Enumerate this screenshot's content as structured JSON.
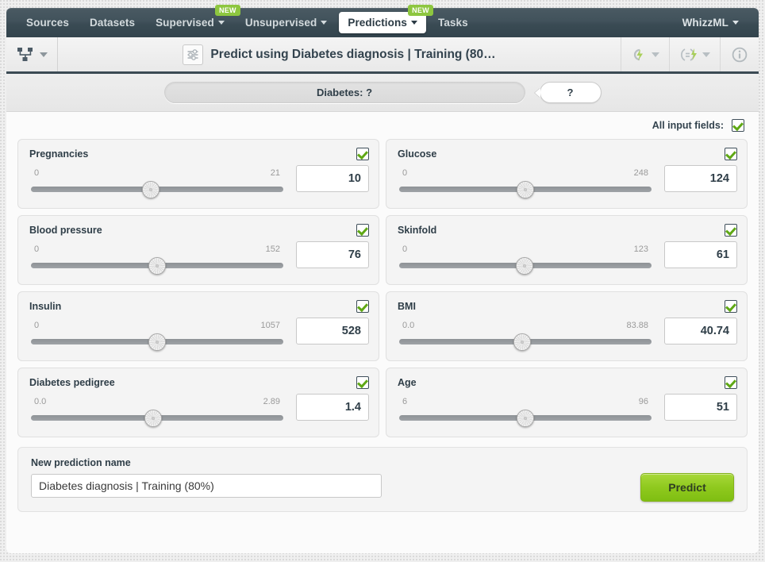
{
  "nav": {
    "items": [
      {
        "label": "Sources",
        "caret": false,
        "badge": null,
        "active": false
      },
      {
        "label": "Datasets",
        "caret": false,
        "badge": null,
        "active": false
      },
      {
        "label": "Supervised",
        "caret": true,
        "badge": "NEW",
        "active": false
      },
      {
        "label": "Unsupervised",
        "caret": true,
        "badge": null,
        "active": false
      },
      {
        "label": "Predictions",
        "caret": true,
        "badge": "NEW",
        "active": true
      },
      {
        "label": "Tasks",
        "caret": false,
        "badge": null,
        "active": false
      }
    ],
    "right": {
      "label": "WhizzML",
      "caret": true
    }
  },
  "toolbar": {
    "left_icon": "model-tree-icon",
    "title_icon": "sliders-icon",
    "title": "Predict using Diabetes diagnosis | Training (80…",
    "right_icons": [
      "cloud-lightning-icon",
      "evaluation-lightning-icon",
      "info-icon"
    ]
  },
  "prediction_bar": {
    "objective": "Diabetes: ?",
    "confidence": "?"
  },
  "all_input_fields": {
    "label": "All input fields:",
    "checked": true
  },
  "fields": [
    {
      "name": "Pregnancies",
      "min": "0",
      "max": "21",
      "value": "10",
      "percent": 47.6,
      "checked": true
    },
    {
      "name": "Glucose",
      "min": "0",
      "max": "248",
      "value": "124",
      "percent": 50.0,
      "checked": true
    },
    {
      "name": "Blood pressure",
      "min": "0",
      "max": "152",
      "value": "76",
      "percent": 50.0,
      "checked": true
    },
    {
      "name": "Skinfold",
      "min": "0",
      "max": "123",
      "value": "61",
      "percent": 49.6,
      "checked": true
    },
    {
      "name": "Insulin",
      "min": "0",
      "max": "1057",
      "value": "528",
      "percent": 50.0,
      "checked": true
    },
    {
      "name": "BMI",
      "min": "0.0",
      "max": "83.88",
      "value": "40.74",
      "percent": 48.6,
      "checked": true
    },
    {
      "name": "Diabetes pedigree",
      "min": "0.0",
      "max": "2.89",
      "value": "1.4",
      "percent": 48.4,
      "checked": true
    },
    {
      "name": "Age",
      "min": "6",
      "max": "96",
      "value": "51",
      "percent": 50.0,
      "checked": true
    }
  ],
  "bottom": {
    "name_label": "New prediction name",
    "name_value": "Diabetes diagnosis | Training (80%)",
    "name_placeholder": "New prediction name",
    "predict_label": "Predict"
  },
  "colors": {
    "brand_green": "#8dc63f",
    "nav_dark": "#3a4b54",
    "text_dark": "#2f3e48"
  }
}
